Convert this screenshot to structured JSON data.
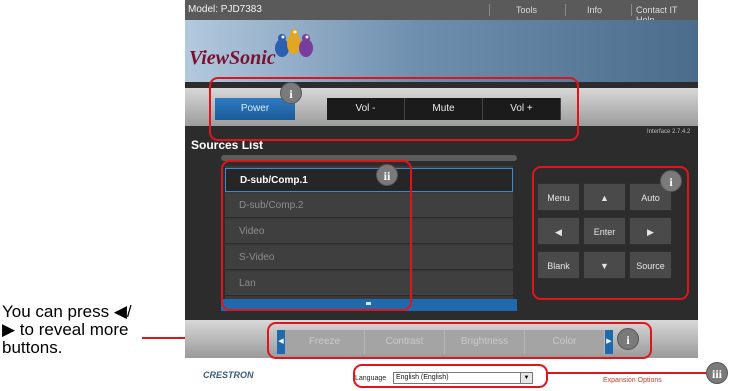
{
  "annotation": {
    "text": "You can press ◀/▶ to reveal more buttons."
  },
  "topbar": {
    "model": "Model: PJD7383",
    "tools": "Tools",
    "info": "Info",
    "contact": "Contact IT Help"
  },
  "banner": {
    "logo": "ViewSonic"
  },
  "power_controls": {
    "power": "Power",
    "vol_down": "Vol -",
    "mute": "Mute",
    "vol_up": "Vol +"
  },
  "version": "Interface 2.7.4.2",
  "sources": {
    "title": "Sources List",
    "items": [
      "D-sub/Comp.1",
      "D-sub/Comp.2",
      "Video",
      "S-Video",
      "Lan"
    ],
    "selected": "D-sub/Comp.1"
  },
  "remote": {
    "menu": "Menu",
    "up": "▲",
    "auto": "Auto",
    "left": "◀",
    "enter": "Enter",
    "right": "▶",
    "blank": "Blank",
    "down": "▼",
    "source": "Source"
  },
  "bottom_controls": {
    "freeze": "Freeze",
    "contrast": "Contrast",
    "brightness": "Brightness",
    "color": "Color",
    "prev": "◀",
    "next": "▶"
  },
  "footer": {
    "crestron": "CRESTRON",
    "language_label": "Language",
    "language_value": "English (English)",
    "language_caret": "▼",
    "expansion": "Expansion Options"
  },
  "badges": {
    "i": "i",
    "ii": "ii",
    "iii": "iii"
  },
  "colors": {
    "highlight": "#e1141c",
    "accent": "#1f6aaf"
  }
}
